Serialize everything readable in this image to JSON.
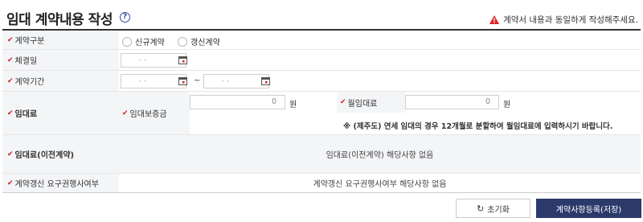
{
  "header": {
    "title": "임대 계약내용 작성",
    "help_icon": "?",
    "notice": "계약서 내용과 동일하게 작성해주세요.",
    "warn_color": "#e02020"
  },
  "rows": {
    "contract_type": {
      "label": "계약구분",
      "options": [
        "신규계약",
        "갱신계약"
      ]
    },
    "signing_date": {
      "label": "체결일",
      "placeholder": "-  -"
    },
    "contract_period": {
      "label": "계약기간",
      "start_placeholder": "-  -",
      "end_placeholder": "-  -",
      "separator": "~"
    },
    "rent": {
      "label": "임대료",
      "deposit_label": "임대보증금",
      "deposit_value": "0",
      "deposit_unit": "원",
      "monthly_label": "월임대료",
      "monthly_value": "0",
      "monthly_unit": "원",
      "note": "※ (제주도) 연세 임대의 경우 12개월로 분할하여 월임대료에 입력하시기 바랍니다."
    },
    "previous_rent": {
      "label": "임대료(이전계약)",
      "value": "임대료(이전계약) 해당사항 없음"
    },
    "renewal_request": {
      "label": "계약갱신 요구권행사여부",
      "value": "계약갱신 요구권행사여부 해당사항 없음"
    }
  },
  "buttons": {
    "reset": "초기화",
    "submit": "계약사항등록(저장)"
  },
  "colors": {
    "accent": "#2b3a6b",
    "required": "#d02020",
    "label_bg": "#f4f5f7"
  }
}
